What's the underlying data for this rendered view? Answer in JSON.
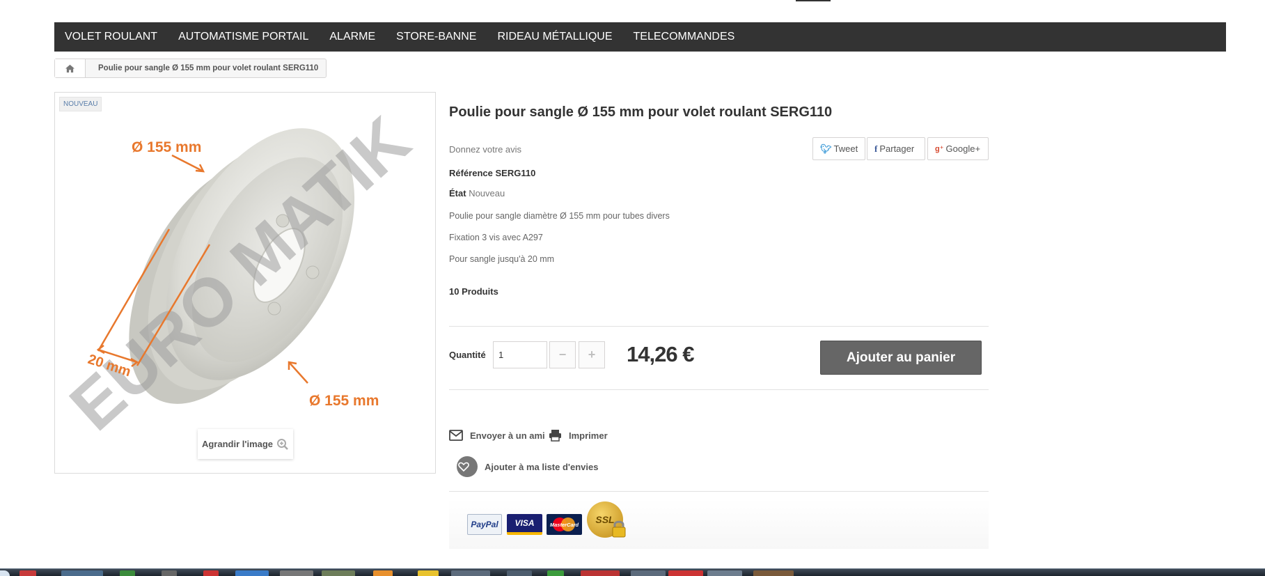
{
  "nav": {
    "items": [
      "VOLET ROULANT",
      "AUTOMATISME PORTAIL",
      "ALARME",
      "STORE-BANNE",
      "RIDEAU MÉTALLIQUE",
      "TELECOMMANDES"
    ]
  },
  "breadcrumb": {
    "home_icon": "home-icon",
    "current": "Poulie pour sangle Ø 155 mm pour volet roulant SERG110"
  },
  "image": {
    "badge": "NOUVEAU",
    "label_top": "Ø 155 mm",
    "label_bottom": "Ø 155 mm",
    "label_width": "20 mm",
    "watermark": "EURO MATIK",
    "zoom_label": "Agrandir l'image",
    "zoom_icon": "zoom-in-icon"
  },
  "product": {
    "title": "Poulie pour sangle Ø 155 mm pour volet roulant SERG110",
    "review": "Donnez votre avis",
    "reference": "Référence SERG110",
    "etat_label": "État",
    "etat_value": "Nouveau",
    "description": [
      "Poulie pour sangle diamètre Ø 155 mm pour tubes divers",
      "Fixation 3 vis avec A297",
      "Pour sangle jusqu'à 20 mm"
    ],
    "stock": "10 Produits",
    "quantity_label": "Quantité",
    "quantity_value": "1",
    "price": "14,26 €",
    "add_to_cart": "Ajouter au panier"
  },
  "social": {
    "tweet": "Tweet",
    "share": "Partager",
    "google": "Google+"
  },
  "actions": {
    "send_friend": "Envoyer à un ami",
    "print": "Imprimer",
    "wishlist": "Ajouter à ma liste d'envies"
  },
  "payment": {
    "paypal": "PayPal",
    "visa": "VISA",
    "mastercard": "MasterCard",
    "ssl": "SSL"
  },
  "colors": {
    "nav_bg": "#333333",
    "button_bg": "#666666",
    "orange_annotation": "#e8782d"
  }
}
